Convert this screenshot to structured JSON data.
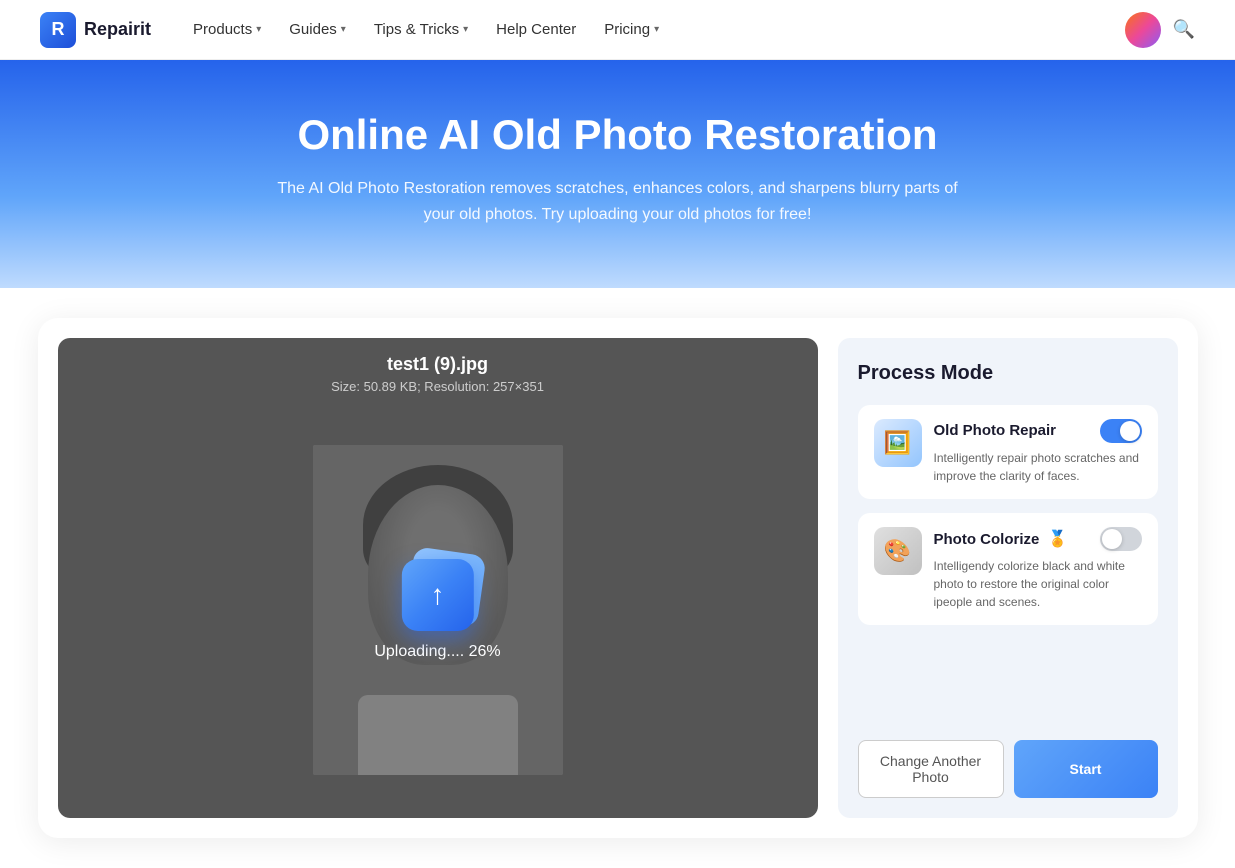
{
  "nav": {
    "logo_text": "Repairit",
    "items": [
      {
        "label": "Products",
        "has_dropdown": true
      },
      {
        "label": "Guides",
        "has_dropdown": true
      },
      {
        "label": "Tips & Tricks",
        "has_dropdown": true
      },
      {
        "label": "Help Center",
        "has_dropdown": false
      },
      {
        "label": "Pricing",
        "has_dropdown": true
      }
    ]
  },
  "hero": {
    "title": "Online AI Old Photo Restoration",
    "subtitle": "The AI Old Photo Restoration removes scratches, enhances colors, and sharpens blurry parts of your old photos. Try uploading your old photos for free!"
  },
  "upload": {
    "filename": "test1 (9).jpg",
    "meta": "Size: 50.89 KB; Resolution: 257×351",
    "progress_text": "Uploading.... 26%"
  },
  "sidebar": {
    "title": "Process Mode",
    "modes": [
      {
        "name": "Old Photo Repair",
        "desc": "Intelligently repair photo scratches and improve the clarity of faces.",
        "toggle_on": true,
        "badge": ""
      },
      {
        "name": "Photo Colorize",
        "desc": "Intelligendy colorize black and white photo to restore the original color ipeople and scenes.",
        "toggle_on": false,
        "badge": "🏅"
      }
    ],
    "btn_change": "Change Another Photo",
    "btn_start": "Start"
  }
}
